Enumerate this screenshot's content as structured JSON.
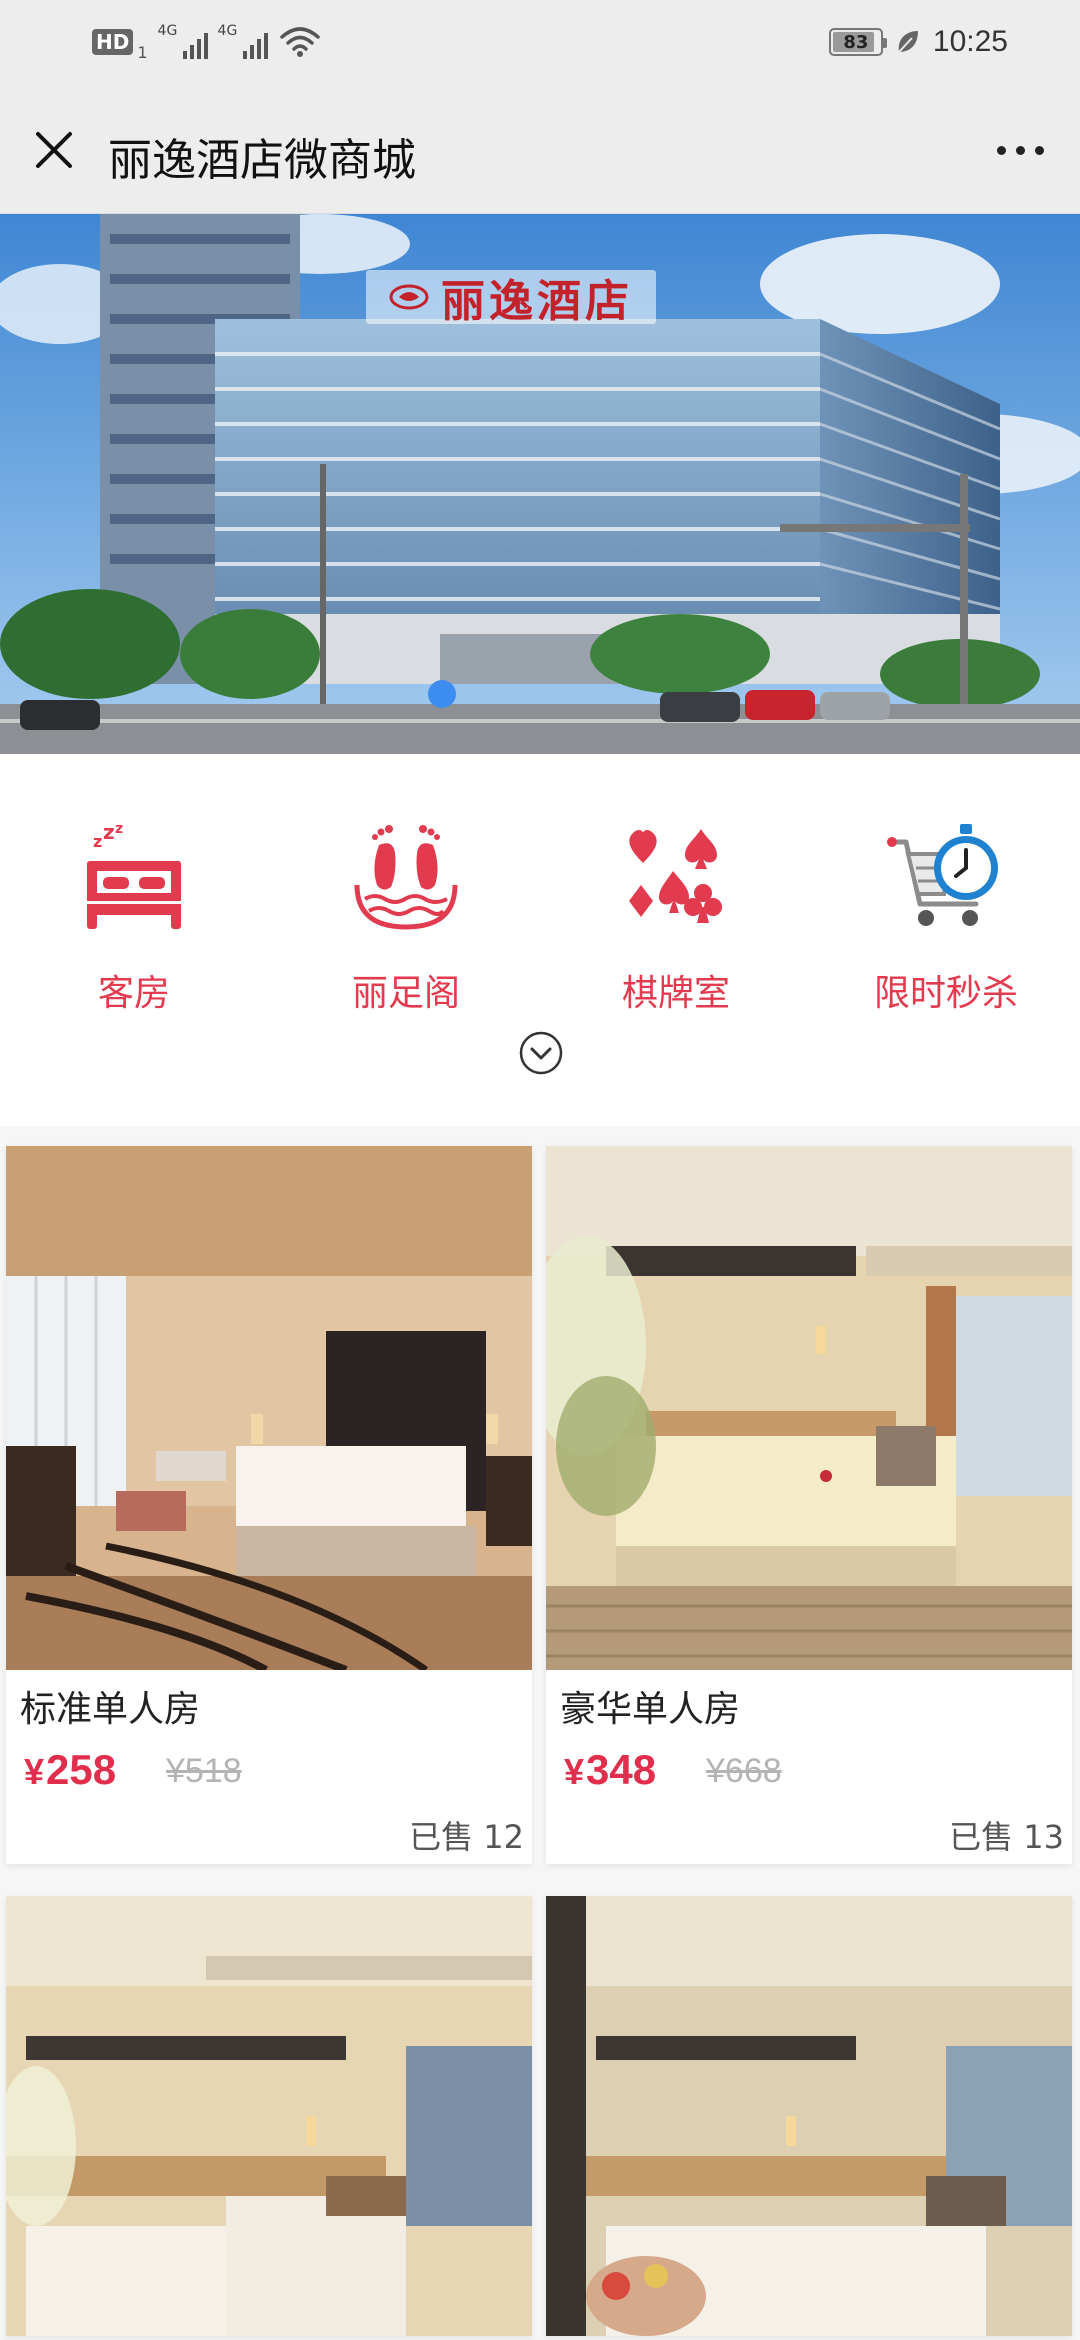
{
  "status_bar": {
    "hd_label": "HD",
    "hd_sub": "1",
    "signal1_label": "4G",
    "signal2_label": "4G",
    "battery_level": "83",
    "time": "10:25"
  },
  "title_bar": {
    "title": "丽逸酒店微商城"
  },
  "banner": {
    "sign_text": "丽逸酒店",
    "active_slide": 1
  },
  "categories": [
    {
      "label": "客房",
      "icon": "bed-icon"
    },
    {
      "label": "丽足阁",
      "icon": "foot-spa-icon"
    },
    {
      "label": "棋牌室",
      "icon": "cards-icon"
    },
    {
      "label": "限时秒杀",
      "icon": "flash-sale-cart-icon"
    }
  ],
  "products": [
    {
      "name": "标准单人房",
      "currency": "¥",
      "price": "258",
      "original_price": "¥518",
      "sold": "已售 12"
    },
    {
      "name": "豪华单人房",
      "currency": "¥",
      "price": "348",
      "original_price": "¥668",
      "sold": "已售 13"
    },
    {
      "name": "",
      "currency": "",
      "price": "",
      "original_price": "",
      "sold": ""
    },
    {
      "name": "",
      "currency": "",
      "price": "",
      "original_price": "",
      "sold": ""
    }
  ],
  "colors": {
    "accent": "#e23a4e",
    "price": "#e02e4c",
    "bar_bg": "#ededed",
    "indicator": "#3d8df0"
  }
}
